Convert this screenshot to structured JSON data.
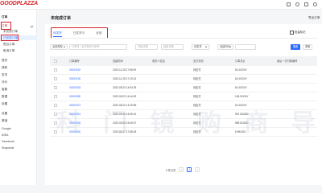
{
  "app": {
    "logo": "GOODPLAZZA"
  },
  "sidebar": {
    "items": [
      {
        "label": "订单",
        "group": true
      },
      {
        "label": "订单"
      },
      {
        "label": "未完成订单"
      },
      {
        "label": "已完成订单",
        "active": true
      },
      {
        "label": "售后订单"
      },
      {
        "label": "取消订单"
      },
      {
        "label": "退货"
      },
      {
        "label": "退款"
      },
      {
        "label": "发货"
      },
      {
        "label": "评价"
      },
      {
        "label": "客服"
      },
      {
        "label": "数据"
      },
      {
        "label": "设置"
      },
      {
        "label": "设置"
      },
      {
        "label": "渠道"
      },
      {
        "label": "Google"
      },
      {
        "label": "IDEA"
      },
      {
        "label": "Facebook"
      },
      {
        "label": "Snapchat"
      }
    ]
  },
  "page": {
    "title": "未完成订单",
    "export_label": "导出订单"
  },
  "tabs": [
    {
      "label": "待发货",
      "active": true
    },
    {
      "label": "已发货中"
    },
    {
      "label": "全部"
    }
  ],
  "toolbar": {
    "mark_label": "批量标记"
  },
  "filters": {
    "order_type": "全部类型",
    "order_search_placeholder": "订单号 / 支付账号订单号",
    "start_date_placeholder": "开始日期",
    "end_date_placeholder": "结束日期",
    "status": "待发货",
    "time_type": "创建时间",
    "search_label": "搜索",
    "reset_label": "重置"
  },
  "table": {
    "columns": [
      "订单编号",
      "创建时间",
      "收货人信息",
      "支付状态",
      "订单总价",
      "最后一次付款编号"
    ],
    "rows": [
      {
        "order": "00000152",
        "time": "2023.11.28 17:55:09",
        "status": "待支付",
        "total": "61.00CNY"
      },
      {
        "order": "00000190",
        "time": "2023.11.28 17:19:13",
        "status": "待支付",
        "total": "61.00CNY"
      },
      {
        "order": "00000015",
        "time": "2023.08.23 14:54:25",
        "status": "待支付",
        "total": "61.00CNY"
      },
      {
        "order": "00000089",
        "time": "2023.08.23 14:44:52",
        "status": "待支付",
        "total": "148.90CNY"
      },
      {
        "order": "00000072",
        "time": "2023.08.23 14:29:59",
        "status": "待支付",
        "total": "61.00CNY"
      },
      {
        "order": "00000031",
        "time": "2023.05.25 15:49:41",
        "status": "待支付",
        "total": "967.50USD"
      },
      {
        "order": "00000035",
        "time": "2023.05.25 15:49:47",
        "status": "待支付",
        "total": "589.61USD"
      },
      {
        "order": "00000030",
        "time": "2023.05.17 17:58:18",
        "status": "待支付",
        "total": "6.99USD"
      }
    ]
  },
  "pagination": {
    "total_label": "8 条记录",
    "current": "1"
  },
  "watermark": "科 门 镜 购 商 导 航"
}
